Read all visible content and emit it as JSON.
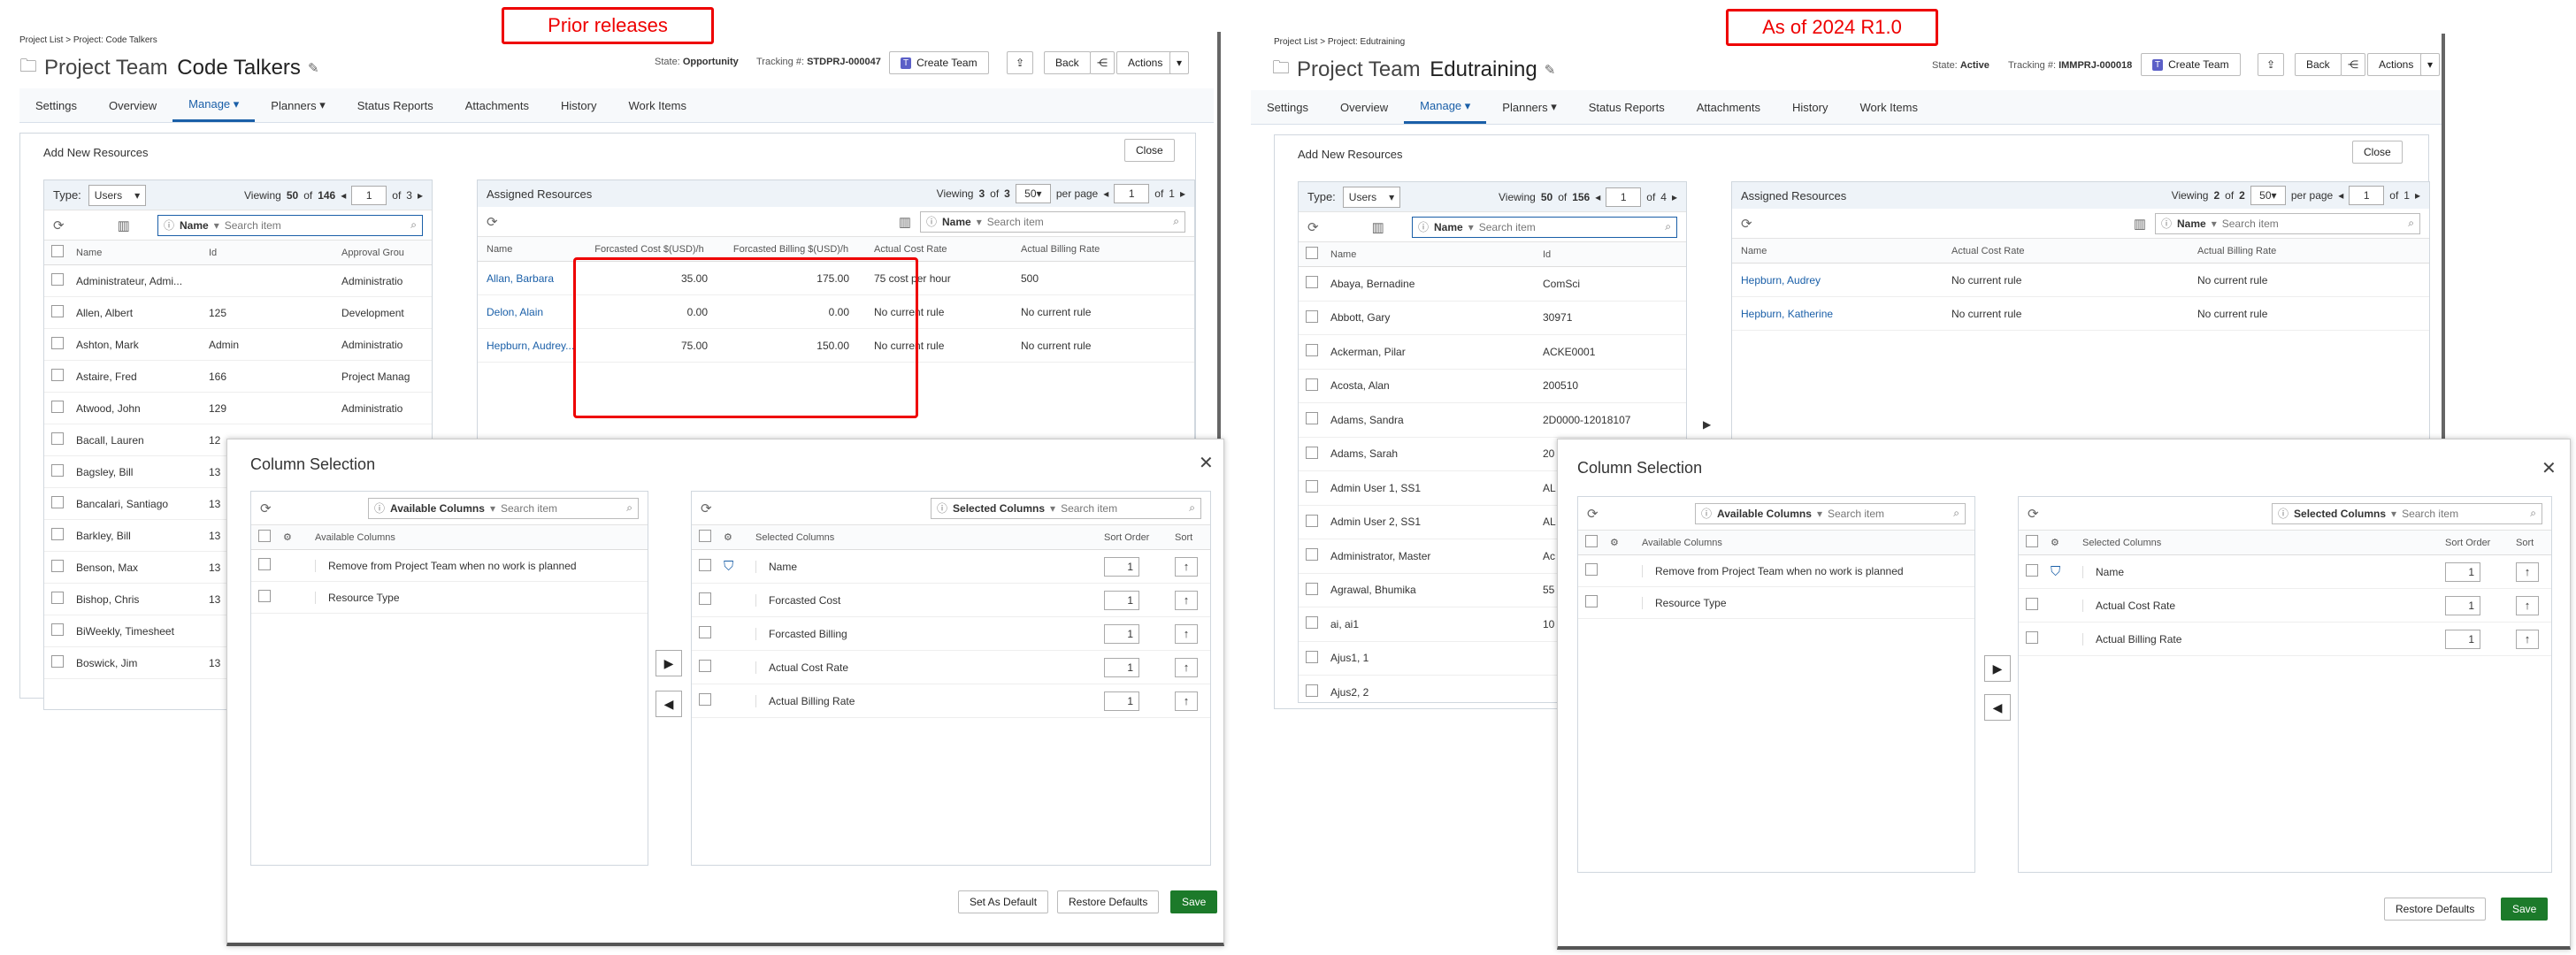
{
  "labels": {
    "left": "Prior releases",
    "right": "As of 2024 R1.0"
  },
  "common": {
    "tabs": [
      "Settings",
      "Overview",
      "Manage",
      "Planners",
      "Status Reports",
      "Attachments",
      "History",
      "Work Items"
    ],
    "project_team": "Project Team",
    "state_label": "State:",
    "tracking_label": "Tracking #:",
    "create_team": "Create Team",
    "back": "Back",
    "actions": "Actions",
    "add_new_resources": "Add New Resources",
    "close": "Close",
    "type_label": "Type:",
    "type_value": "Users",
    "viewing": "Viewing",
    "of": "of",
    "per_page": "per page",
    "name_filter": "Name",
    "search_placeholder": "Search item",
    "assigned_resources": "Assigned Resources",
    "col_name": "Name",
    "col_id": "Id",
    "col_approval": "Approval Grou",
    "col_fc_cost": "Forcasted Cost $(USD)/h",
    "col_fc_bill": "Forcasted Billing $(USD)/h",
    "col_act_cost": "Actual Cost Rate",
    "col_act_bill": "Actual Billing Rate",
    "dlg_title": "Column Selection",
    "available_columns": "Available Columns",
    "selected_columns": "Selected Columns",
    "sort_order": "Sort Order",
    "sort": "Sort",
    "available": [
      "Remove from Project Team when no work is planned",
      "Resource Type"
    ],
    "set_default": "Set As Default",
    "restore": "Restore Defaults",
    "save": "Save"
  },
  "left": {
    "breadcrumb": "Project List > Project: Code Talkers",
    "project_name": "Code Talkers",
    "state": "Opportunity",
    "tracking": "STDPRJ-000047",
    "viewing_count": "50",
    "total": "146",
    "page": "1",
    "pages": "3",
    "assigned_viewing": "3",
    "assigned_total": "3",
    "assigned_perpage": "50",
    "assigned_page": "1",
    "assigned_pages": "1",
    "users": [
      {
        "name": "Administrateur, Admi...",
        "id": "",
        "approval": "Administratio"
      },
      {
        "name": "Allen, Albert",
        "id": "125",
        "approval": "Development"
      },
      {
        "name": "Ashton, Mark",
        "id": "Admin",
        "approval": "Administratio"
      },
      {
        "name": "Astaire, Fred",
        "id": "166",
        "approval": "Project Manag"
      },
      {
        "name": "Atwood, John",
        "id": "129",
        "approval": "Administratio"
      },
      {
        "name": "Bacall, Lauren",
        "id": "12",
        "approval": ""
      },
      {
        "name": "Bagsley, Bill",
        "id": "13",
        "approval": ""
      },
      {
        "name": "Bancalari, Santiago",
        "id": "13",
        "approval": ""
      },
      {
        "name": "Barkley, Bill",
        "id": "13",
        "approval": ""
      },
      {
        "name": "Benson, Max",
        "id": "13",
        "approval": ""
      },
      {
        "name": "Bishop, Chris",
        "id": "13",
        "approval": ""
      },
      {
        "name": "BiWeekly, Timesheet",
        "id": "",
        "approval": ""
      },
      {
        "name": "Boswick, Jim",
        "id": "13",
        "approval": ""
      }
    ],
    "assigned": [
      {
        "name": "Allan, Barbara",
        "fc_cost": "35.00",
        "fc_bill": "175.00",
        "act_cost": "75 cost per hour",
        "act_bill": "500"
      },
      {
        "name": "Delon, Alain",
        "fc_cost": "0.00",
        "fc_bill": "0.00",
        "act_cost": "No current rule",
        "act_bill": "No current rule"
      },
      {
        "name": "Hepburn, Audrey...",
        "fc_cost": "75.00",
        "fc_bill": "150.00",
        "act_cost": "No current rule",
        "act_bill": "No current rule"
      }
    ],
    "selected": [
      {
        "name": "Name",
        "order": "1"
      },
      {
        "name": "Forcasted Cost",
        "order": "1"
      },
      {
        "name": "Forcasted Billing",
        "order": "1"
      },
      {
        "name": "Actual Cost Rate",
        "order": "1"
      },
      {
        "name": "Actual Billing Rate",
        "order": "1"
      }
    ]
  },
  "right": {
    "breadcrumb": "Project List > Project: Edutraining",
    "project_name": "Edutraining",
    "state": "Active",
    "tracking": "IMMPRJ-000018",
    "viewing_count": "50",
    "total": "156",
    "page": "1",
    "pages": "4",
    "assigned_viewing": "2",
    "assigned_total": "2",
    "assigned_perpage": "50",
    "assigned_page": "1",
    "assigned_pages": "1",
    "users": [
      {
        "name": "Abaya, Bernadine",
        "id": "ComSci"
      },
      {
        "name": "Abbott, Gary",
        "id": "30971"
      },
      {
        "name": "Ackerman, Pilar",
        "id": "ACKE0001"
      },
      {
        "name": "Acosta, Alan",
        "id": "200510"
      },
      {
        "name": "Adams, Sandra",
        "id": "2D0000-12018107"
      },
      {
        "name": "Adams, Sarah",
        "id": "20"
      },
      {
        "name": "Admin User 1, SS1",
        "id": "AL"
      },
      {
        "name": "Admin User 2, SS1",
        "id": "AL"
      },
      {
        "name": "Administrator, Master",
        "id": "Ac"
      },
      {
        "name": "Agrawal, Bhumika",
        "id": "55"
      },
      {
        "name": "ai, ai1",
        "id": "10"
      },
      {
        "name": "Ajus1, 1",
        "id": ""
      },
      {
        "name": "Ajus2, 2",
        "id": ""
      }
    ],
    "assigned": [
      {
        "name": "Hepburn, Audrey",
        "act_cost": "No current rule",
        "act_bill": "No current rule"
      },
      {
        "name": "Hepburn, Katherine",
        "act_cost": "No current rule",
        "act_bill": "No current rule"
      }
    ],
    "selected": [
      {
        "name": "Name",
        "order": "1"
      },
      {
        "name": "Actual Cost Rate",
        "order": "1"
      },
      {
        "name": "Actual Billing Rate",
        "order": "1"
      }
    ]
  },
  "colors": {
    "accent": "#1a5fa8",
    "save": "#1c7a2a",
    "highlight": "#e00000"
  }
}
